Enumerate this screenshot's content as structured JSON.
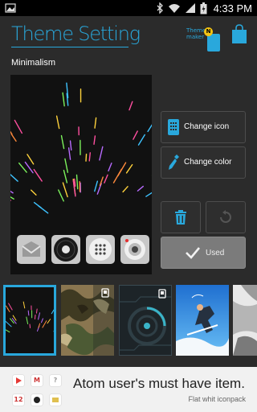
{
  "status_bar": {
    "time": "4:33 PM",
    "icons": [
      "picture-icon",
      "bluetooth-icon",
      "wifi-icon",
      "signal-icon",
      "battery-icon"
    ]
  },
  "header": {
    "title": "Theme Setting",
    "theme_maker_label": "Theme maker",
    "badge": "N",
    "accent": "#29a8dc"
  },
  "section": {
    "label": "Minimalism"
  },
  "preview": {
    "icons": [
      "mail-icon",
      "record-icon",
      "dialpad-icon",
      "camera-icon"
    ]
  },
  "actions": {
    "change_icon": "Change icon",
    "change_color": "Change color",
    "used": "Used"
  },
  "thumbnails": [
    "Minimalism",
    "Camouflage",
    "Circuit dark",
    "Sky jump",
    "Monochrome"
  ],
  "ad": {
    "title": "Atom user's must have item.",
    "subtitle": "Flat whit iconpack",
    "icon_badges": [
      "12",
      "M",
      "?"
    ]
  }
}
